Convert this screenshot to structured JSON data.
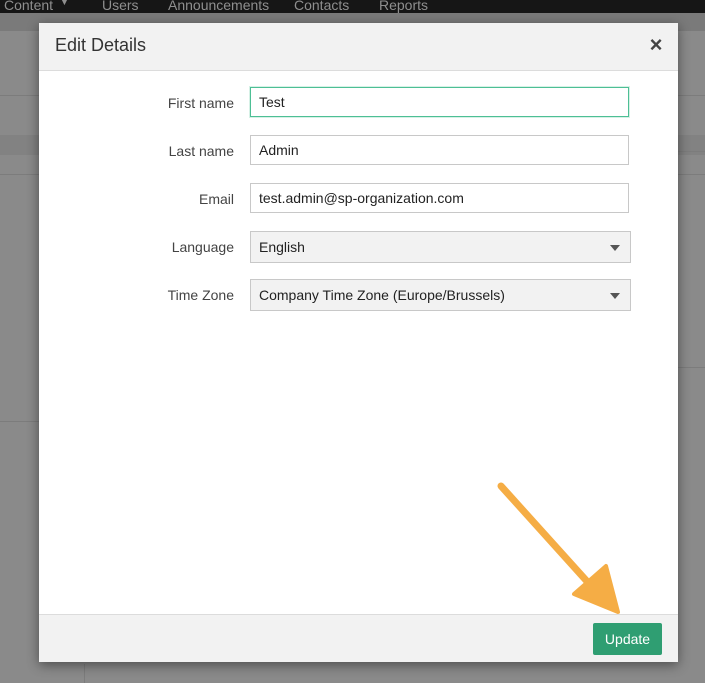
{
  "topnav": {
    "items": [
      "Content",
      "Users",
      "Announcements",
      "Contacts",
      "Reports"
    ]
  },
  "modal": {
    "title": "Edit Details",
    "close_symbol": "×",
    "fields": [
      {
        "label": "First name",
        "value": "Test",
        "type": "text",
        "focused": true
      },
      {
        "label": "Last name",
        "value": "Admin",
        "type": "text"
      },
      {
        "label": "Email",
        "value": "test.admin@sp-organization.com",
        "type": "text"
      },
      {
        "label": "Language",
        "value": "English",
        "type": "select"
      },
      {
        "label": "Time Zone",
        "value": "Company Time Zone (Europe/Brussels)",
        "type": "select"
      }
    ],
    "update_label": "Update"
  },
  "colors": {
    "primary_button": "#2f9e72",
    "focus_border": "#4dbf95",
    "annotation_arrow": "#f5ad45"
  },
  "icons": [
    "close-icon",
    "chevron-down-icon",
    "arrow-annotation"
  ]
}
